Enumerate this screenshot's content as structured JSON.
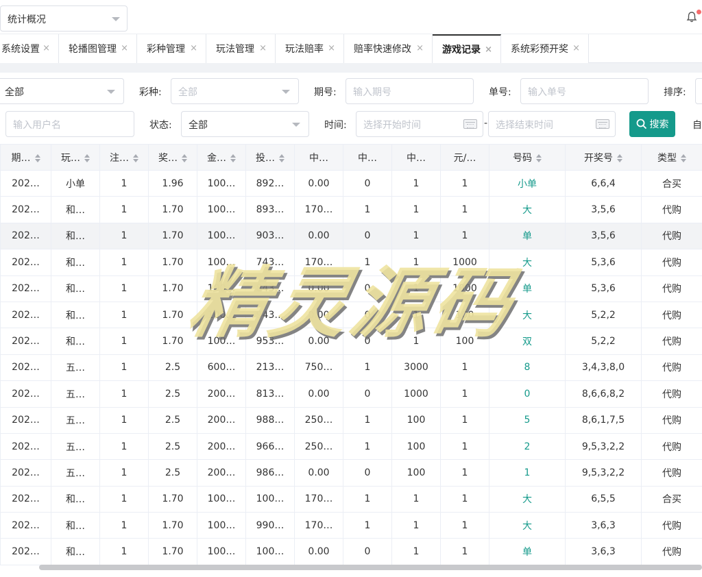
{
  "topbar": {
    "module_select": "统计概况"
  },
  "tabs": [
    {
      "label": "系统设置"
    },
    {
      "label": "轮播图管理"
    },
    {
      "label": "彩种管理"
    },
    {
      "label": "玩法管理"
    },
    {
      "label": "玩法赔率"
    },
    {
      "label": "赔率快速修改"
    },
    {
      "label": "游戏记录",
      "active": true
    },
    {
      "label": "系统彩预开奖"
    }
  ],
  "tab_close": "×",
  "filters": {
    "row1": {
      "first_value": "全部",
      "lottery_label": "彩种:",
      "lottery_value": "全部",
      "period_label": "期号:",
      "period_placeholder": "输入期号",
      "order_label": "单号:",
      "order_placeholder": "输入单号",
      "sort_label": "排序:"
    },
    "row2": {
      "user_placeholder": "输入用户名",
      "status_label": "状态:",
      "status_value": "全部",
      "time_label": "时间:",
      "start_placeholder": "选择开始时间",
      "range_sep": "-",
      "end_placeholder": "选择结束时间",
      "search_button": "搜索",
      "trailing": "自"
    }
  },
  "table": {
    "headers": [
      "期…",
      "玩…",
      "注…",
      "奖…",
      "金…",
      "投…",
      "中…",
      "中…",
      "中…",
      "元/…",
      "号码",
      "开奖号",
      "类型"
    ],
    "rows": [
      [
        "202…",
        "小单",
        "1",
        "1.96",
        "100…",
        "892…",
        "0.00",
        "0",
        "1",
        "1",
        "小单",
        "6,6,4",
        "合买"
      ],
      [
        "202…",
        "和…",
        "1",
        "1.70",
        "100…",
        "893…",
        "170…",
        "1",
        "1",
        "1",
        "大",
        "3,5,6",
        "代购"
      ],
      [
        "202…",
        "和…",
        "1",
        "1.70",
        "100…",
        "903…",
        "0.00",
        "0",
        "1",
        "1",
        "单",
        "3,5,6",
        "代购"
      ],
      [
        "202…",
        "和…",
        "1",
        "1.70",
        "100…",
        "743…",
        "170…",
        "1",
        "1",
        "1000",
        "大",
        "5,3,6",
        "代购"
      ],
      [
        "202…",
        "和…",
        "1",
        "1.70",
        "100…",
        "843…",
        "0.00",
        "0",
        "1",
        "1000",
        "单",
        "5,3,6",
        "代购"
      ],
      [
        "202…",
        "和…",
        "1",
        "1.70",
        "100…",
        "943…",
        "0.00",
        "0",
        "1",
        "100",
        "大",
        "5,2,2",
        "代购"
      ],
      [
        "202…",
        "和…",
        "1",
        "1.70",
        "100…",
        "953…",
        "0.00",
        "0",
        "1",
        "100",
        "双",
        "5,2,2",
        "代购"
      ],
      [
        "202…",
        "五…",
        "1",
        "2.5",
        "600…",
        "213…",
        "750…",
        "1",
        "3000",
        "1",
        "8",
        "3,4,3,8,0",
        "代购"
      ],
      [
        "202…",
        "五…",
        "1",
        "2.5",
        "200…",
        "813…",
        "0.00",
        "0",
        "1000",
        "1",
        "0",
        "8,6,6,8,2",
        "代购"
      ],
      [
        "202…",
        "五…",
        "1",
        "2.5",
        "200…",
        "988…",
        "250…",
        "1",
        "100",
        "1",
        "5",
        "8,6,1,7,5",
        "代购"
      ],
      [
        "202…",
        "五…",
        "1",
        "2.5",
        "200…",
        "966…",
        "250…",
        "1",
        "100",
        "1",
        "2",
        "9,5,3,2,2",
        "代购"
      ],
      [
        "202…",
        "五…",
        "1",
        "2.5",
        "200…",
        "986…",
        "0.00",
        "0",
        "100",
        "1",
        "1",
        "9,5,3,2,2",
        "代购"
      ],
      [
        "202…",
        "和…",
        "1",
        "1.70",
        "100…",
        "100…",
        "170…",
        "1",
        "1",
        "1",
        "大",
        "6,5,5",
        "合买"
      ],
      [
        "202…",
        "和…",
        "1",
        "1.70",
        "100…",
        "990…",
        "170…",
        "1",
        "1",
        "1",
        "大",
        "3,6,3",
        "代购"
      ],
      [
        "202…",
        "和…",
        "1",
        "1.70",
        "100…",
        "100…",
        "0.00",
        "0",
        "1",
        "1",
        "单",
        "3,6,3",
        "代购"
      ]
    ],
    "highlight_row": 2
  },
  "watermark": "精灵源码",
  "colors": {
    "accent": "#159a8b",
    "badge": "#f56c6c"
  },
  "icons": {
    "bell": "bell-icon",
    "search": "search-icon",
    "calendar": "calendar-icon",
    "close": "close-icon",
    "sort": "sort-icon",
    "dropdown": "chevron-down-icon"
  }
}
